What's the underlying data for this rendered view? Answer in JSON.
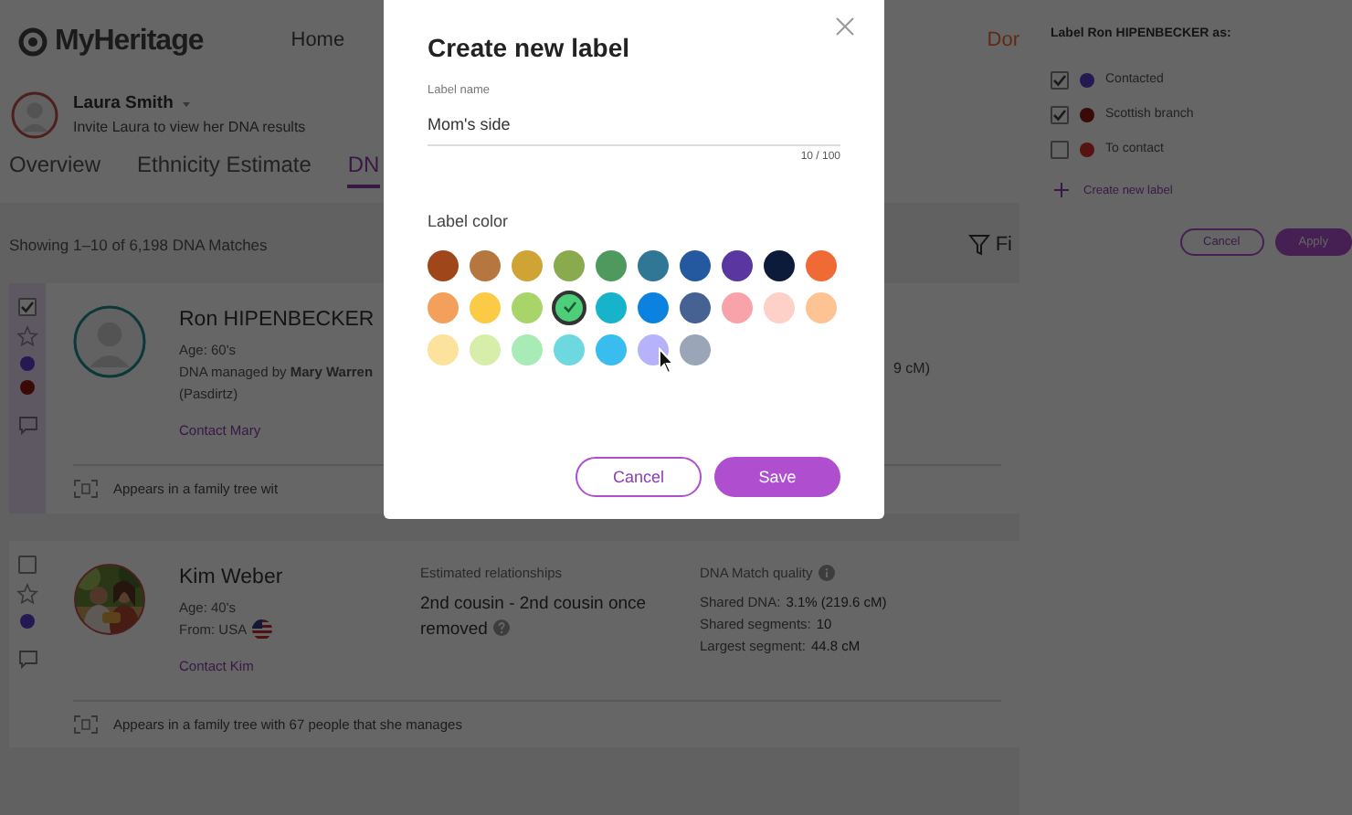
{
  "header": {
    "logo": "MyHeritage",
    "nav": [
      {
        "label": "Home",
        "kind": "link"
      },
      {
        "label": "Dor",
        "kind": "accent"
      }
    ]
  },
  "profile": {
    "name": "Laura Smith",
    "invite": "Invite Laura to view her DNA results"
  },
  "tabs": [
    {
      "label": "Overview",
      "selected": false
    },
    {
      "label": "Ethnicity Estimate",
      "selected": false
    },
    {
      "label": "DN",
      "selected": true
    }
  ],
  "results": {
    "summary": "Showing 1–10 of 6,198 DNA Matches",
    "filter": "Fi"
  },
  "matches": [
    {
      "name": "Ron HIPENBECKER",
      "selected": true,
      "kind": "silhouette",
      "labels": [
        {
          "color": "#241953"
        },
        {
          "color": "#380b07"
        }
      ],
      "details": [
        "Age: 60's",
        "DNA managed by **Mary Warren**",
        "(Pasdirtz)"
      ],
      "contact": "Contact Mary",
      "dna_fragment": "9 cM)",
      "tree": "Appears in a family tree wit"
    },
    {
      "name": "Kim Weber",
      "selected": false,
      "labels": [
        {
          "color": "#241953"
        }
      ],
      "details": [
        "Age: 40's",
        "From: USA"
      ],
      "flag": true,
      "contact": "Contact Kim",
      "relationship_heading": "Estimated relationships",
      "relationship": "2nd cousin - 2nd cousin once removed",
      "quality_heading": "DNA Match quality",
      "stats": [
        {
          "label": "Shared DNA:",
          "value": "3.1% (219.6 cM)"
        },
        {
          "label": "Shared segments:",
          "value": "10"
        },
        {
          "label": "Largest segment:",
          "value": "44.8 cM"
        }
      ],
      "tree": "Appears in a family tree with 67 people that she manages"
    }
  ],
  "label_panel": {
    "title": "Label Ron HIPENBECKER as:",
    "labels": [
      {
        "name": "Contacted",
        "checked": true,
        "color": "#241953"
      },
      {
        "name": "Scottish branch",
        "checked": true,
        "color": "#380b07"
      },
      {
        "name": "To contact",
        "checked": false,
        "color": "#551311"
      }
    ],
    "create": "Create new label",
    "buttons": [
      {
        "label": "Cancel",
        "kind": "outline"
      },
      {
        "label": "Apply",
        "kind": "primary"
      }
    ]
  },
  "dialog": {
    "title": "Create new label",
    "field_label": "Label name",
    "value": "Mom's side",
    "counter": "10 / 100",
    "color_heading": "Label color",
    "swatches": [
      {
        "color": "#a0461b",
        "selected": false
      },
      {
        "color": "#b5773f",
        "selected": false
      },
      {
        "color": "#cfa334",
        "selected": false
      },
      {
        "color": "#8aaa4e",
        "selected": false
      },
      {
        "color": "#4e9a5e",
        "selected": false
      },
      {
        "color": "#2f7794",
        "selected": false
      },
      {
        "color": "#24599f",
        "selected": false
      },
      {
        "color": "#5a36a0",
        "selected": false
      },
      {
        "color": "#0d1b3a",
        "selected": false
      },
      {
        "color": "#f06a35",
        "selected": false
      },
      {
        "color": "#f2a05c",
        "selected": false
      },
      {
        "color": "#fbcb46",
        "selected": false
      },
      {
        "color": "#a9d46a",
        "selected": false
      },
      {
        "color": "#4ccf78",
        "selected": true
      },
      {
        "color": "#16b3cb",
        "selected": false
      },
      {
        "color": "#0b82e0",
        "selected": false
      },
      {
        "color": "#456293",
        "selected": false
      },
      {
        "color": "#f7a3a9",
        "selected": false
      },
      {
        "color": "#fdd0c8",
        "selected": false
      },
      {
        "color": "#fdc393",
        "selected": false
      },
      {
        "color": "#fde29d",
        "selected": false
      },
      {
        "color": "#d7eeaa",
        "selected": false
      },
      {
        "color": "#a8ebb7",
        "selected": false
      },
      {
        "color": "#6ed8e0",
        "selected": false
      },
      {
        "color": "#39bdee",
        "selected": false
      },
      {
        "color": "#b7b3fb",
        "selected": false
      },
      {
        "color": "#9aa5b8",
        "selected": false
      }
    ],
    "buttons": [
      {
        "label": "Cancel",
        "kind": "outline"
      },
      {
        "label": "Save",
        "kind": "primary"
      }
    ]
  }
}
